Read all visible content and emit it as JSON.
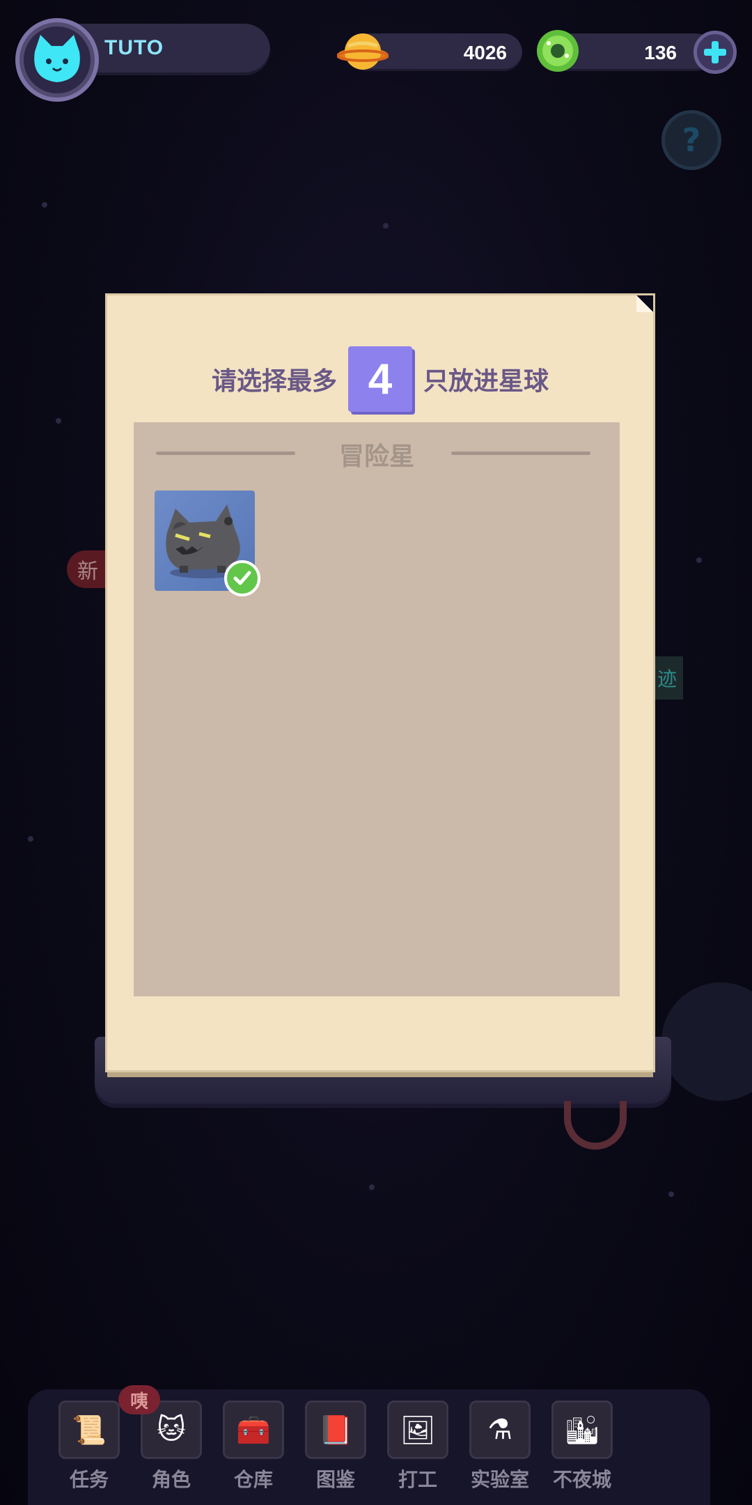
{
  "player": {
    "name": "TUTO"
  },
  "currencies": {
    "coins": {
      "value": "4026",
      "icon": "planet-coin-icon"
    },
    "gems": {
      "value": "136",
      "icon": "donut-gem-icon"
    }
  },
  "dialog": {
    "title_prefix": "请选择最多",
    "max_count": "4",
    "title_suffix": "只放进星球",
    "section_title": "冒险星",
    "selected_pet": {
      "icon": "grey-wolf-pet-icon",
      "selected": true
    }
  },
  "background": {
    "new_badge": "新",
    "side_tag": "迹"
  },
  "nav": {
    "badge": "咦",
    "items": [
      {
        "label": "任务",
        "icon": "scroll-icon"
      },
      {
        "label": "角色",
        "icon": "cat-portrait-icon"
      },
      {
        "label": "仓库",
        "icon": "chest-icon"
      },
      {
        "label": "图鉴",
        "icon": "book-icon"
      },
      {
        "label": "打工",
        "icon": "picture-frame-icon"
      },
      {
        "label": "实验室",
        "icon": "flask-icon"
      },
      {
        "label": "不夜城",
        "icon": "city-cat-icon"
      }
    ]
  },
  "colors": {
    "accent": "#8d81ee",
    "dialog_bg": "#f3e3c3",
    "panel_bg": "#cbb9a9",
    "check": "#62c64a"
  }
}
